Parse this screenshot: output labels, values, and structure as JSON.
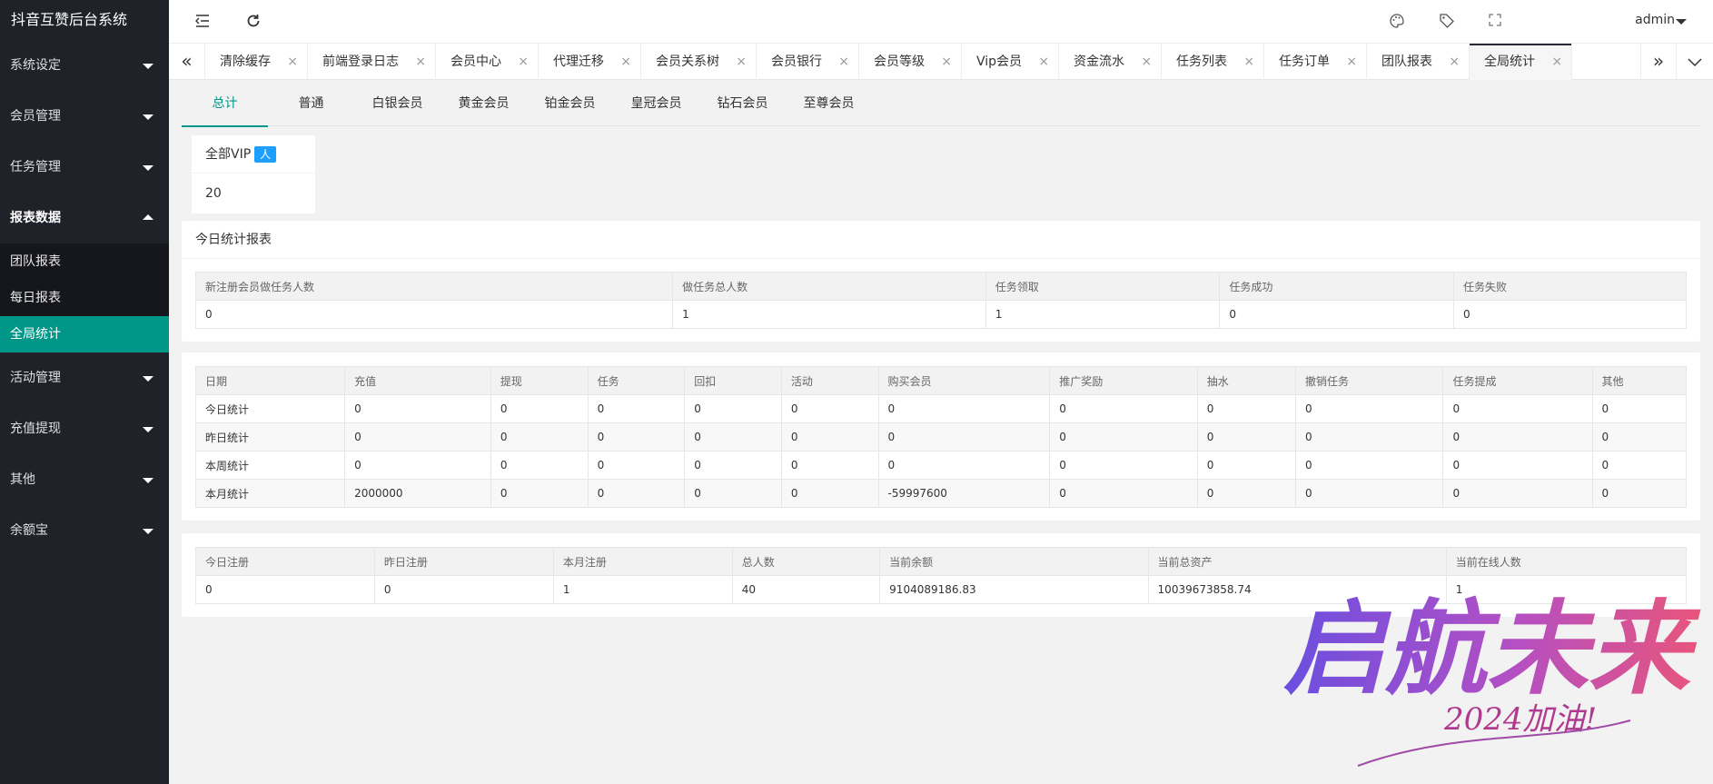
{
  "app_title": "抖音互赞后台系统",
  "sidebar": {
    "items": [
      {
        "label": "系统设定"
      },
      {
        "label": "会员管理"
      },
      {
        "label": "任务管理"
      },
      {
        "label": "报表数据",
        "sub": [
          "团队报表",
          "每日报表",
          "全局统计"
        ]
      },
      {
        "label": "活动管理"
      },
      {
        "label": "充值提现"
      },
      {
        "label": "其他"
      },
      {
        "label": "余额宝"
      }
    ]
  },
  "header": {
    "user": "admin"
  },
  "tabs": [
    "清除缓存",
    "前端登录日志",
    "会员中心",
    "代理迁移",
    "会员关系树",
    "会员银行",
    "会员等级",
    "Vip会员",
    "资金流水",
    "任务列表",
    "任务订单",
    "团队报表",
    "全局统计"
  ],
  "vip_tabs": [
    "总计",
    "普通",
    "白银会员",
    "黄金会员",
    "铂金会员",
    "皇冠会员",
    "钻石会员",
    "至尊会员"
  ],
  "vip_card": {
    "title": "全部VIP",
    "badge": "人",
    "value": "20"
  },
  "today_report": {
    "title": "今日统计报表",
    "headers": [
      "新注册会员做任务人数",
      "做任务总人数",
      "任务领取",
      "任务成功",
      "任务失败"
    ],
    "row": [
      "0",
      "1",
      "1",
      "0",
      "0"
    ]
  },
  "finance": {
    "headers": [
      "日期",
      "充值",
      "提现",
      "任务",
      "回扣",
      "活动",
      "购买会员",
      "推广奖励",
      "抽水",
      "撤销任务",
      "任务提成",
      "其他"
    ],
    "rows": [
      [
        "今日统计",
        "0",
        "0",
        "0",
        "0",
        "0",
        "0",
        "0",
        "0",
        "0",
        "0",
        "0"
      ],
      [
        "昨日统计",
        "0",
        "0",
        "0",
        "0",
        "0",
        "0",
        "0",
        "0",
        "0",
        "0",
        "0"
      ],
      [
        "本周统计",
        "0",
        "0",
        "0",
        "0",
        "0",
        "0",
        "0",
        "0",
        "0",
        "0",
        "0"
      ],
      [
        "本月统计",
        "2000000",
        "0",
        "0",
        "0",
        "0",
        "-59997600",
        "0",
        "0",
        "0",
        "0",
        "0"
      ]
    ]
  },
  "members": {
    "headers": [
      "今日注册",
      "昨日注册",
      "本月注册",
      "总人数",
      "当前余额",
      "当前总资产",
      "当前在线人数"
    ],
    "row": [
      "0",
      "0",
      "1",
      "40",
      "9104089186.83",
      "10039673858.74",
      "1"
    ]
  },
  "watermark": {
    "main": "启航未来",
    "sub": "2024加油!"
  },
  "colors": {
    "sidebar": "#20222a",
    "accent": "#009688",
    "badge": "#1e9fff"
  }
}
